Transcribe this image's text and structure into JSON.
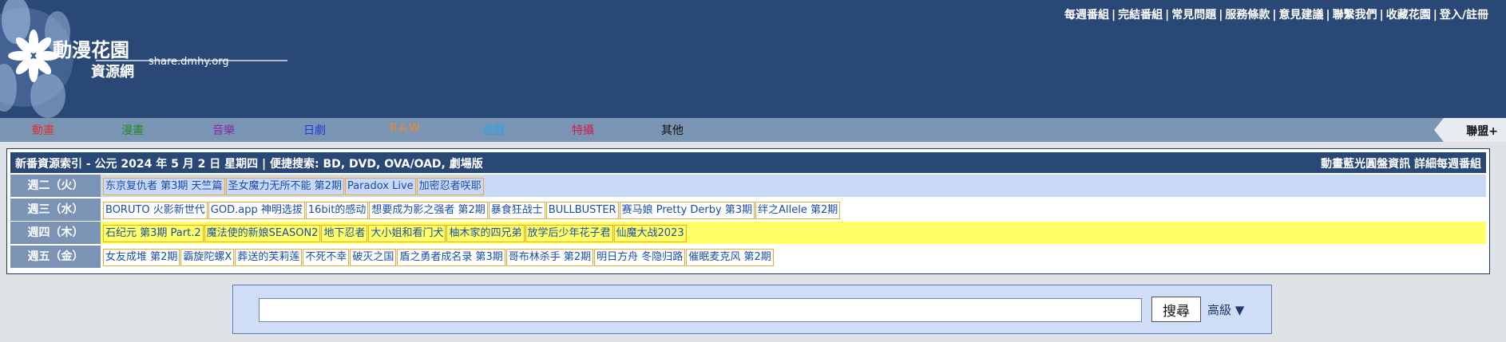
{
  "logo": {
    "title": "動漫花園",
    "subtitle": "資源網",
    "domain": "share.dmhy.org"
  },
  "top_links": [
    "每週番組",
    "完結番組",
    "常見問題",
    "服務條款",
    "意見建議",
    "聯繫我們",
    "收藏花園",
    "登入/註冊"
  ],
  "nav": [
    {
      "label": "動畫",
      "color": "#e03030"
    },
    {
      "label": "漫畫",
      "color": "#1e8a2a"
    },
    {
      "label": "音樂",
      "color": "#8a2aa0"
    },
    {
      "label": "日劇",
      "color": "#1a3adc"
    },
    {
      "label": "RAW",
      "color": "#f08a1e"
    },
    {
      "label": "遊戲",
      "color": "#2aa0e8"
    },
    {
      "label": "特攝",
      "color": "#d02050"
    },
    {
      "label": "其他",
      "color": "#111111"
    }
  ],
  "partner_label": "聯盟+",
  "board": {
    "header_left": "新番資源索引 - 公元 2024 年 5 月 2 日 星期四 | 便捷搜索: BD, DVD, OVA/OAD, 劇場版",
    "header_right": "動畫藍光圓盤資訊 詳細每週番組",
    "rows": [
      {
        "day": "週二（火）",
        "highlight": "#c9d9f5",
        "shows": [
          "东京复仇者 第3期 天竺篇",
          "圣女魔力无所不能 第2期",
          "Paradox Live",
          "加密忍者咲耶"
        ]
      },
      {
        "day": "週三（水）",
        "highlight": "#ffffff",
        "shows": [
          "BORUTO 火影新世代",
          "GOD.app 神明选拔",
          "16bit的感动",
          "想要成为影之强者 第2期",
          "暴食狂战士",
          "BULLBUSTER",
          "赛马娘 Pretty Derby 第3期",
          "绊之Allele 第2期"
        ]
      },
      {
        "day": "週四（木）",
        "highlight": "#ffff66",
        "shows": [
          "石纪元 第3期 Part.2",
          "魔法使的新娘SEASON2",
          "地下忍者",
          "大小姐和看门犬",
          "柚木家的四兄弟",
          "放学后少年花子君",
          "仙魔大战2023"
        ]
      },
      {
        "day": "週五（金）",
        "highlight": "#ffffff",
        "shows": [
          "女友成堆 第2期",
          "霸旋陀螺X",
          "葬送的芙莉莲",
          "不死不幸",
          "破灭之国",
          "盾之勇者成名录 第3期",
          "哥布林杀手 第2期",
          "明日方舟 冬隐归路",
          "催眠麦克风 第2期"
        ]
      }
    ]
  },
  "search": {
    "input_value": "",
    "button_label": "搜尋",
    "advanced_label": "高級 ▼"
  }
}
